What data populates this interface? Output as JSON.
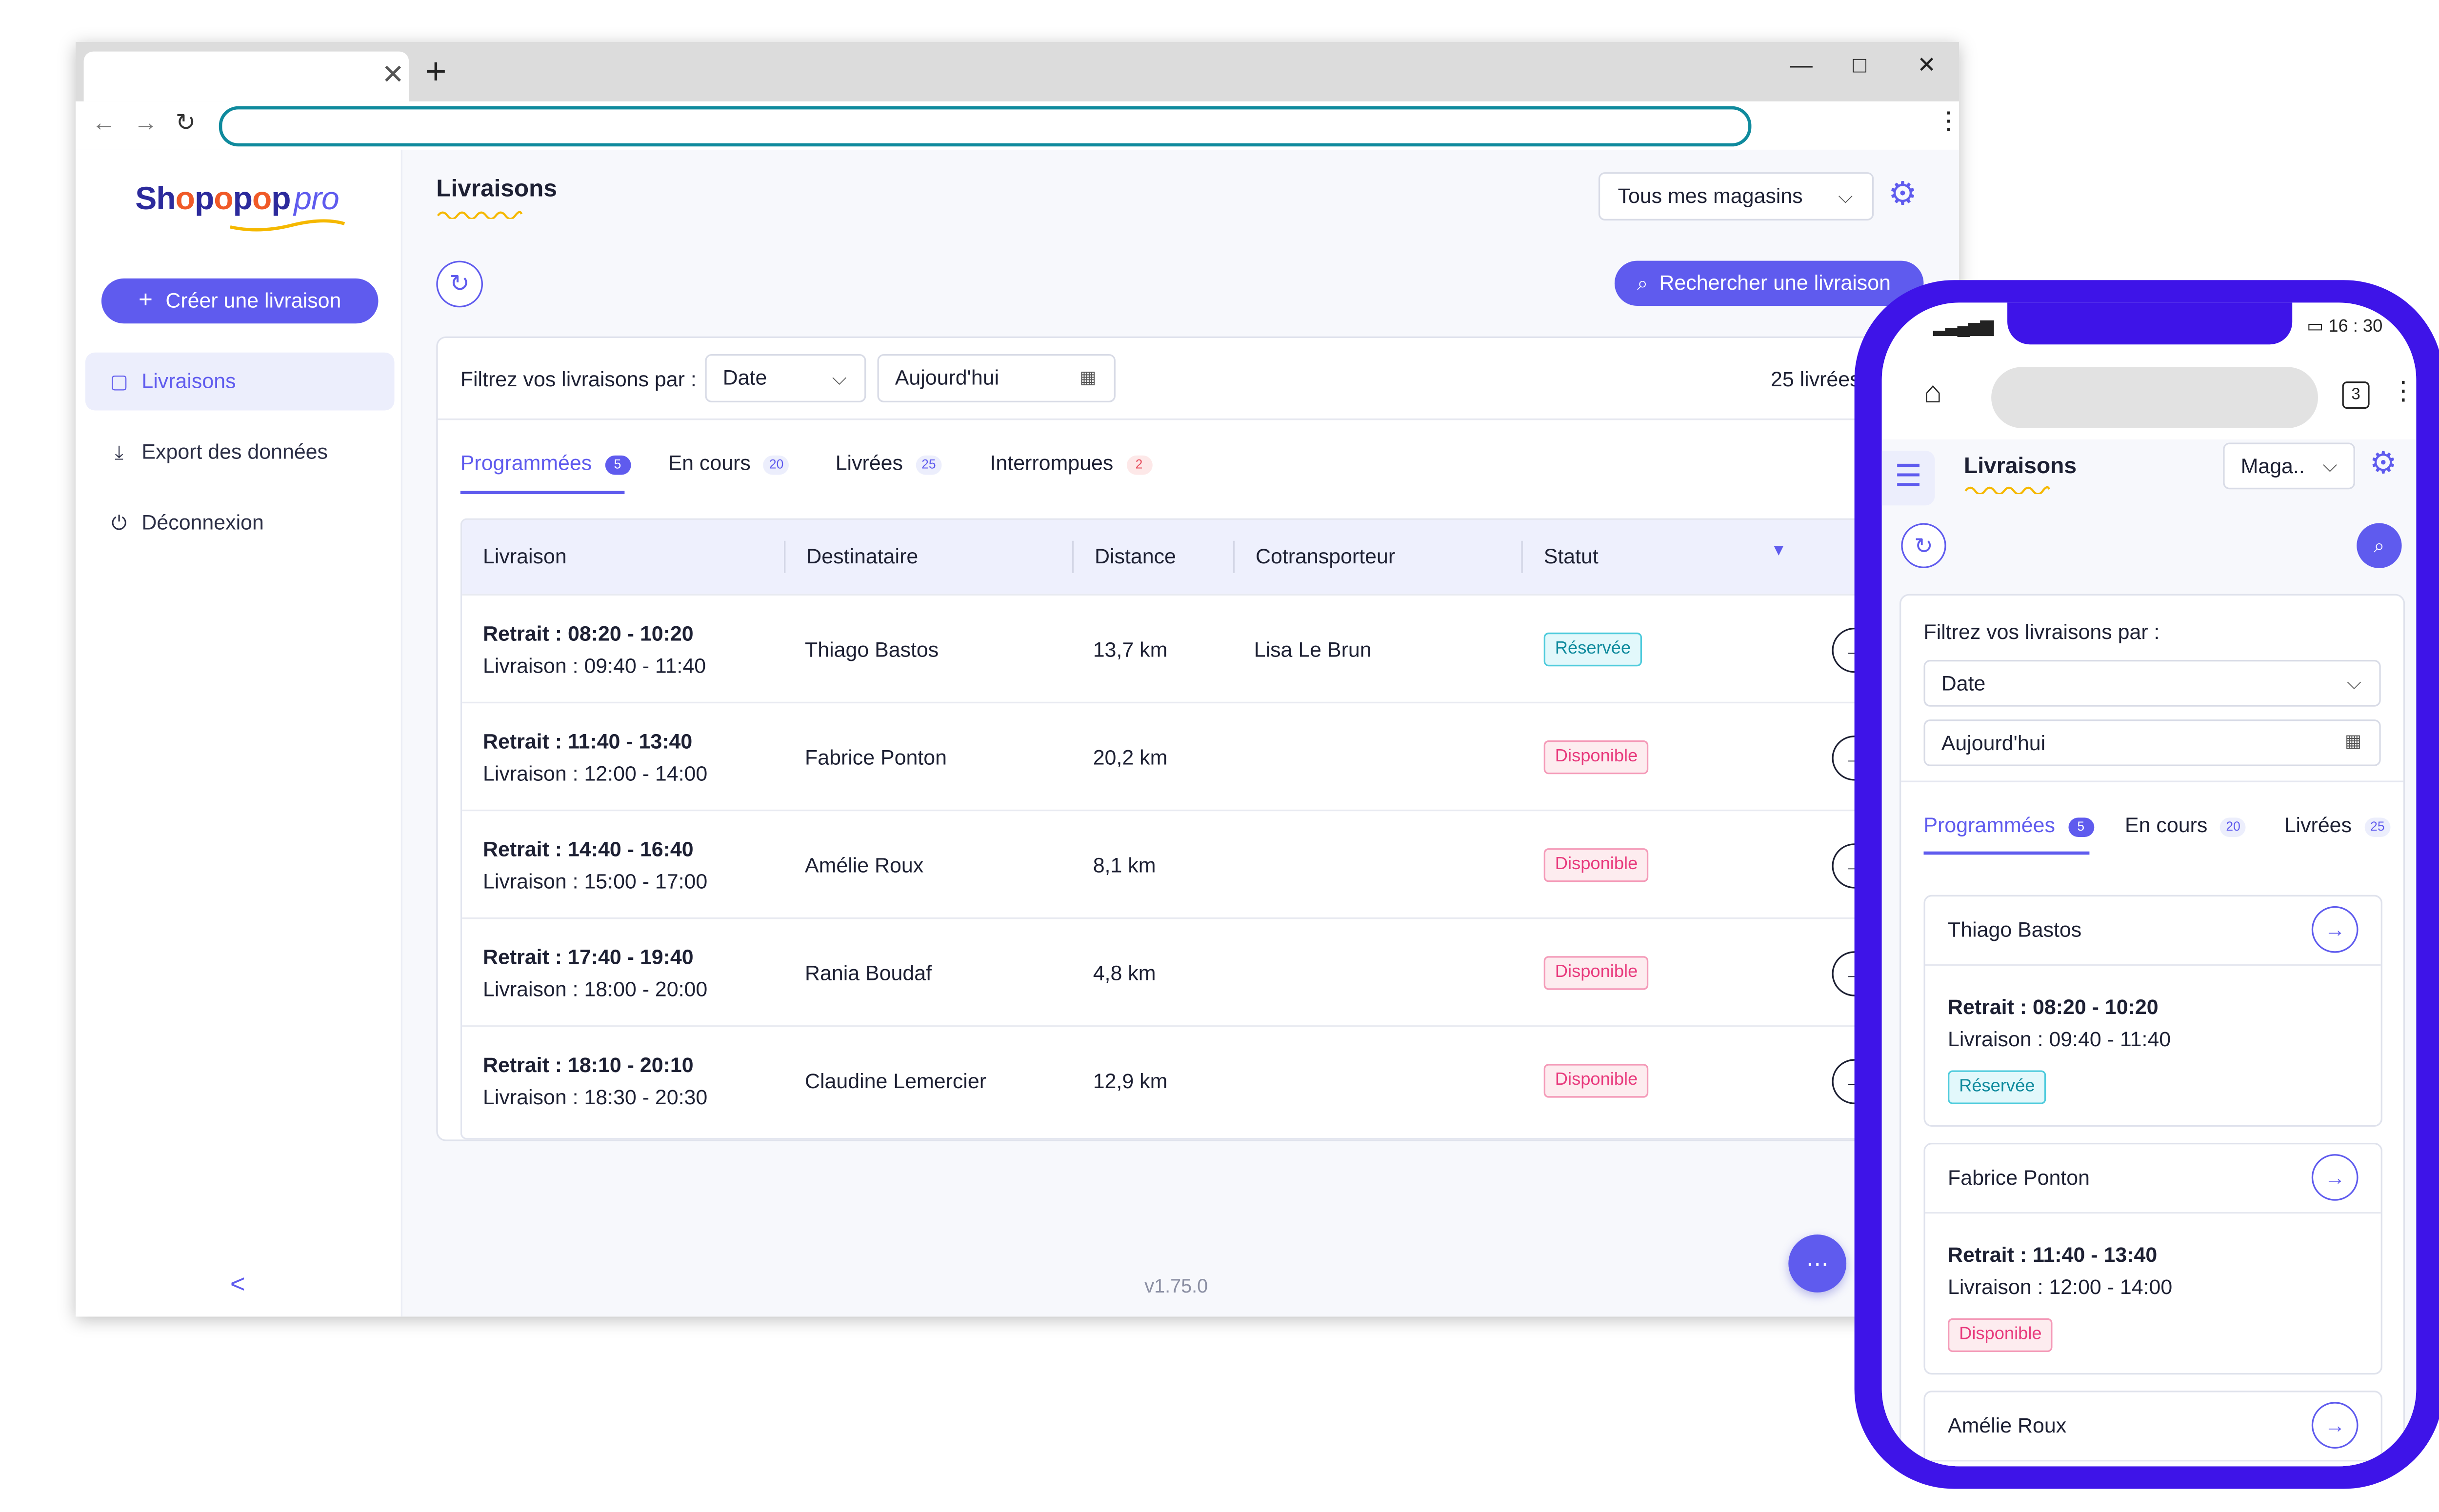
{
  "browser": {
    "tab_close": "✕",
    "new_tab": "+",
    "window_controls": [
      "—",
      "□",
      "✕"
    ],
    "nav_icons": [
      "back-arrow-icon",
      "forward-arrow-icon",
      "reload-icon",
      "menu-kebab-icon"
    ]
  },
  "brand": {
    "name_a": "Sh",
    "dot1": "o",
    "name_b": "p",
    "dot2": "o",
    "name_c": "p",
    "dot3": "o",
    "name_d": "p",
    "suffix": "pro"
  },
  "sidebar": {
    "create_label": "Créer une livraison",
    "items": [
      {
        "label": "Livraisons",
        "icon": "shopping-bag-icon",
        "active": true
      },
      {
        "label": "Export des données",
        "icon": "download-icon",
        "active": false
      },
      {
        "label": "Déconnexion",
        "icon": "power-icon",
        "active": false
      }
    ],
    "collapse": "<"
  },
  "header": {
    "title": "Livraisons",
    "store_select": "Tous mes magasins",
    "search_label": "Rechercher une livraison"
  },
  "filters": {
    "label": "Filtrez vos livraisons par :",
    "type": "Date",
    "date": "Aujourd'hui",
    "total": "25 livrées"
  },
  "tabs": [
    {
      "label": "Programmées",
      "count": "5"
    },
    {
      "label": "En cours",
      "count": "20"
    },
    {
      "label": "Livrées",
      "count": "25"
    },
    {
      "label": "Interrompues",
      "count": "2"
    }
  ],
  "table": {
    "headers": [
      "Livraison",
      "Destinataire",
      "Distance",
      "Cotransporteur",
      "Statut"
    ],
    "rows": [
      {
        "pickup": "Retrait : 08:20 - 10:20",
        "delivery": "Livraison : 09:40 - 11:40",
        "recipient": "Thiago Bastos",
        "distance": "13,7 km",
        "carrier": "Lisa Le Brun",
        "status": "Réservée"
      },
      {
        "pickup": "Retrait : 11:40 - 13:40",
        "delivery": "Livraison : 12:00 - 14:00",
        "recipient": "Fabrice Ponton",
        "distance": "20,2 km",
        "carrier": "",
        "status": "Disponible"
      },
      {
        "pickup": "Retrait : 14:40 - 16:40",
        "delivery": "Livraison : 15:00 - 17:00",
        "recipient": "Amélie Roux",
        "distance": "8,1 km",
        "carrier": "",
        "status": "Disponible"
      },
      {
        "pickup": "Retrait : 17:40 - 19:40",
        "delivery": "Livraison : 18:00 - 20:00",
        "recipient": "Rania Boudaf",
        "distance": "4,8 km",
        "carrier": "",
        "status": "Disponible"
      },
      {
        "pickup": "Retrait : 18:10 - 20:10",
        "delivery": "Livraison : 18:30 - 20:30",
        "recipient": "Claudine Lemercier",
        "distance": "12,9 km",
        "carrier": "",
        "status": "Disponible"
      }
    ]
  },
  "footer": {
    "version": "v1.75.0"
  },
  "colors": {
    "accent": "#5f5bee",
    "phone_frame": "#3e14e8",
    "reserved": "#0f8a9d",
    "available": "#e83a7d"
  },
  "phone": {
    "time": "16 : 30",
    "tab_count": "3",
    "title": "Livraisons",
    "store_select": "Maga..",
    "filter_label": "Filtrez vos livraisons par :",
    "type": "Date",
    "date": "Aujourd'hui",
    "tabs": [
      {
        "label": "Programmées",
        "count": "5"
      },
      {
        "label": "En cours",
        "count": "20"
      },
      {
        "label": "Livrées",
        "count": "25"
      }
    ],
    "cards": [
      {
        "name": "Thiago Bastos",
        "pickup": "Retrait : 08:20 - 10:20",
        "delivery": "Livraison : 09:40 - 11:40",
        "status": "Réservée"
      },
      {
        "name": "Fabrice Ponton",
        "pickup": "Retrait : 11:40 - 13:40",
        "delivery": "Livraison : 12:00 - 14:00",
        "status": "Disponible"
      },
      {
        "name": "Amélie Roux"
      }
    ]
  }
}
